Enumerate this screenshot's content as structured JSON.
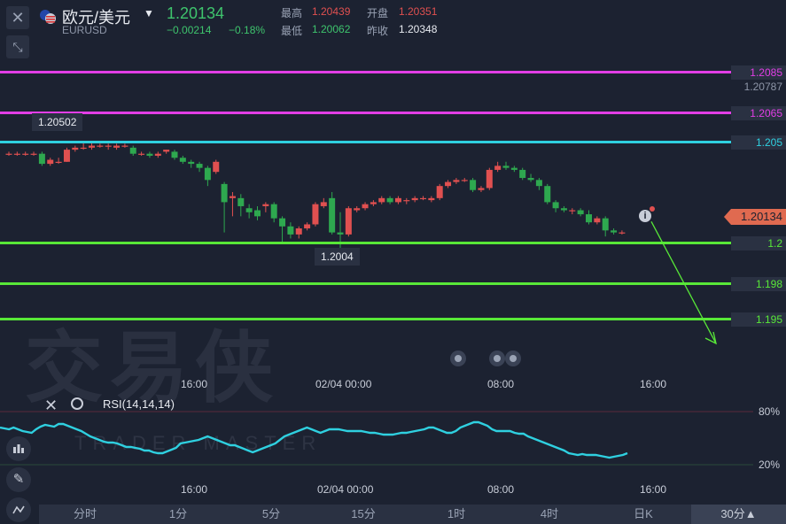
{
  "header": {
    "close_icon": "close-icon",
    "collapse_icon": "collapse-icon",
    "pair_name": "欧元/美元",
    "pair_code": "EURUSD",
    "last_price": "1.20134",
    "change_abs": "−0.00214",
    "change_pct": "−0.18%",
    "stats": {
      "high_label": "最高",
      "high_value": "1.20439",
      "open_label": "开盘",
      "open_value": "1.20351",
      "low_label": "最低",
      "low_value": "1.20062",
      "prev_close_label": "昨收",
      "prev_close_value": "1.20348"
    }
  },
  "price_lines": [
    {
      "label": "1.2085",
      "color": "#e23ee6"
    },
    {
      "label": "1.2065",
      "color": "#e23ee6"
    },
    {
      "label": "1.205",
      "color": "#2fd0e0"
    },
    {
      "label": "1.2",
      "color": "#58e838"
    },
    {
      "label": "1.198",
      "color": "#58e838"
    },
    {
      "label": "1.195",
      "color": "#58e838"
    }
  ],
  "axis_price_gray": "1.20787",
  "current_price_tag": "1.20134",
  "callouts": {
    "high": "1.20502",
    "low": "1.2004"
  },
  "x_axis_main": [
    "16:00",
    "02/04 00:00",
    "08:00",
    "16:00"
  ],
  "x_axis_rsi": [
    "16:00",
    "02/04 00:00",
    "08:00",
    "16:00"
  ],
  "rsi": {
    "label": "RSI(14,14,14)",
    "level_80": "80%",
    "level_20": "20%",
    "color": "#2fd0e0",
    "values": [
      62,
      61,
      60,
      62,
      60,
      58,
      57,
      56,
      60,
      63,
      65,
      64,
      63,
      66,
      66,
      64,
      62,
      60,
      58,
      55,
      52,
      50,
      48,
      46,
      45,
      45,
      44,
      42,
      40,
      40,
      39,
      38,
      36,
      36,
      34,
      33,
      33,
      35,
      37,
      39,
      44,
      45,
      46,
      47,
      48,
      50,
      52,
      50,
      48,
      46,
      44,
      42,
      42,
      40,
      38,
      36,
      34,
      36,
      38,
      40,
      42,
      44,
      48,
      52,
      54,
      56,
      58,
      60,
      62,
      60,
      58,
      56,
      58,
      60,
      60,
      60,
      59,
      58,
      58,
      58,
      58,
      57,
      56,
      56,
      55,
      54,
      54,
      54,
      55,
      56,
      56,
      57,
      58,
      59,
      60,
      62,
      62,
      60,
      58,
      56,
      56,
      58,
      62,
      64,
      66,
      68,
      68,
      66,
      64,
      60,
      58,
      58,
      58,
      58,
      56,
      55,
      55,
      52,
      50,
      48,
      46,
      44,
      42,
      40,
      38,
      36,
      33,
      32,
      31,
      32,
      31,
      31,
      31,
      30,
      29,
      28,
      29,
      30,
      31,
      33
    ]
  },
  "candles": [
    [
      1.2044,
      1.2044,
      1.2045,
      1.2043
    ],
    [
      1.2044,
      1.2044,
      1.2045,
      1.2043
    ],
    [
      1.2044,
      1.2044,
      1.2045,
      1.2043
    ],
    [
      1.2044,
      1.2044,
      1.2045,
      1.2043
    ],
    [
      1.2044,
      1.2039,
      1.2045,
      1.2038
    ],
    [
      1.2039,
      1.2041,
      1.2042,
      1.2038
    ],
    [
      1.204,
      1.204,
      1.2042,
      1.2039
    ],
    [
      1.204,
      1.2046,
      1.2047,
      1.204
    ],
    [
      1.2046,
      1.2047,
      1.2048,
      1.2045
    ],
    [
      1.2047,
      1.2047,
      1.205,
      1.2046
    ],
    [
      1.2047,
      1.2048,
      1.205,
      1.2046
    ],
    [
      1.2048,
      1.2048,
      1.2049,
      1.2047
    ],
    [
      1.2048,
      1.2048,
      1.2049,
      1.2046
    ],
    [
      1.2047,
      1.2048,
      1.2049,
      1.2046
    ],
    [
      1.2048,
      1.2048,
      1.2049,
      1.2047
    ],
    [
      1.2047,
      1.2044,
      1.2048,
      1.2043
    ],
    [
      1.2044,
      1.2044,
      1.2045,
      1.2043
    ],
    [
      1.2044,
      1.2043,
      1.2045,
      1.2042
    ],
    [
      1.2043,
      1.2044,
      1.2045,
      1.2042
    ],
    [
      1.2045,
      1.2046,
      1.2046,
      1.2044
    ],
    [
      1.2045,
      1.2042,
      1.2046,
      1.2041
    ],
    [
      1.2042,
      1.204,
      1.2043,
      1.2039
    ],
    [
      1.204,
      1.2039,
      1.2041,
      1.2037
    ],
    [
      1.2039,
      1.2037,
      1.204,
      1.2035
    ],
    [
      1.2037,
      1.2031,
      1.2038,
      1.2028
    ],
    [
      1.2035,
      1.204,
      1.2041,
      1.2034
    ],
    [
      1.2029,
      1.202,
      1.203,
      1.2005
    ],
    [
      1.2022,
      1.2023,
      1.2025,
      1.2013
    ],
    [
      1.2022,
      1.2018,
      1.2024,
      1.2013
    ],
    [
      1.2017,
      1.2015,
      1.2019,
      1.2012
    ],
    [
      1.2016,
      1.2013,
      1.2018,
      1.2011
    ],
    [
      1.2018,
      1.2019,
      1.202,
      1.2015
    ],
    [
      1.2019,
      1.2012,
      1.202,
      1.201
    ],
    [
      1.2012,
      1.2008,
      1.2013,
      1.2
    ],
    [
      1.2008,
      1.2004,
      1.201,
      1.2002
    ],
    [
      1.2004,
      1.2007,
      1.2008,
      1.2002
    ],
    [
      1.2007,
      1.2009,
      1.201,
      1.2006
    ],
    [
      1.2009,
      1.2019,
      1.202,
      1.2008
    ],
    [
      1.2018,
      1.202,
      1.2022,
      1.2017
    ],
    [
      1.2022,
      1.2005,
      1.2025,
      1.2004
    ],
    [
      1.2005,
      1.2004,
      1.2015,
      1.1994
    ],
    [
      1.2004,
      1.2017,
      1.2018,
      1.2003
    ],
    [
      1.2016,
      1.2017,
      1.2018,
      1.2015
    ],
    [
      1.2017,
      1.2019,
      1.202,
      1.2016
    ],
    [
      1.2019,
      1.202,
      1.2021,
      1.2018
    ],
    [
      1.202,
      1.2022,
      1.2023,
      1.2019
    ],
    [
      1.2022,
      1.202,
      1.2023,
      1.2019
    ],
    [
      1.202,
      1.2022,
      1.2023,
      1.2019
    ],
    [
      1.2021,
      1.2021,
      1.2022,
      1.2019
    ],
    [
      1.2021,
      1.2022,
      1.2023,
      1.202
    ],
    [
      1.2022,
      1.2022,
      1.2023,
      1.2021
    ],
    [
      1.2021,
      1.2022,
      1.2023,
      1.202
    ],
    [
      1.2022,
      1.2028,
      1.2029,
      1.2021
    ],
    [
      1.2028,
      1.203,
      1.2031,
      1.2027
    ],
    [
      1.203,
      1.2031,
      1.2032,
      1.2029
    ],
    [
      1.2031,
      1.2031,
      1.2032,
      1.203
    ],
    [
      1.2031,
      1.2026,
      1.2032,
      1.2025
    ],
    [
      1.2026,
      1.2027,
      1.2028,
      1.2025
    ],
    [
      1.2027,
      1.2036,
      1.2037,
      1.2026
    ],
    [
      1.2036,
      1.2038,
      1.204,
      1.2035
    ],
    [
      1.2038,
      1.2037,
      1.204,
      1.2036
    ],
    [
      1.2037,
      1.2036,
      1.2038,
      1.2035
    ],
    [
      1.2036,
      1.2032,
      1.2037,
      1.2031
    ],
    [
      1.2032,
      1.2031,
      1.2034,
      1.203
    ],
    [
      1.2031,
      1.2028,
      1.2032,
      1.2026
    ],
    [
      1.2028,
      1.202,
      1.2029,
      1.2019
    ],
    [
      1.202,
      1.2017,
      1.2021,
      1.2015
    ],
    [
      1.2017,
      1.2016,
      1.2018,
      1.2015
    ],
    [
      1.2016,
      1.2016,
      1.2017,
      1.2014
    ],
    [
      1.2016,
      1.2014,
      1.2017,
      1.2013
    ],
    [
      1.2014,
      1.201,
      1.2016,
      1.2009
    ],
    [
      1.201,
      1.2012,
      1.2013,
      1.2009
    ],
    [
      1.2012,
      1.2006,
      1.2013,
      1.2003
    ],
    [
      1.2006,
      1.2005,
      1.2007,
      1.2004
    ],
    [
      1.2005,
      1.2005,
      1.2006,
      1.2004
    ]
  ],
  "arrow": {
    "from_price": 1.2006,
    "to_price": 1.195,
    "color": "#58e838"
  },
  "timeframes": [
    "分时",
    "1分",
    "5分",
    "15分",
    "1时",
    "4时",
    "日K",
    "30分▲"
  ],
  "active_timeframe": "30分▲",
  "watermark": {
    "title": "交易侠",
    "subtitle": "TRADER MASTER"
  },
  "rsi_tools": {
    "close_icon": "close-icon",
    "settings_icon": "settings-icon"
  },
  "side_tools": [
    "indicator-icon",
    "pencil-icon",
    "chart-type-icon"
  ],
  "colors": {
    "up": "#e05050",
    "down": "#2ea84f",
    "bg": "#1c2231"
  }
}
